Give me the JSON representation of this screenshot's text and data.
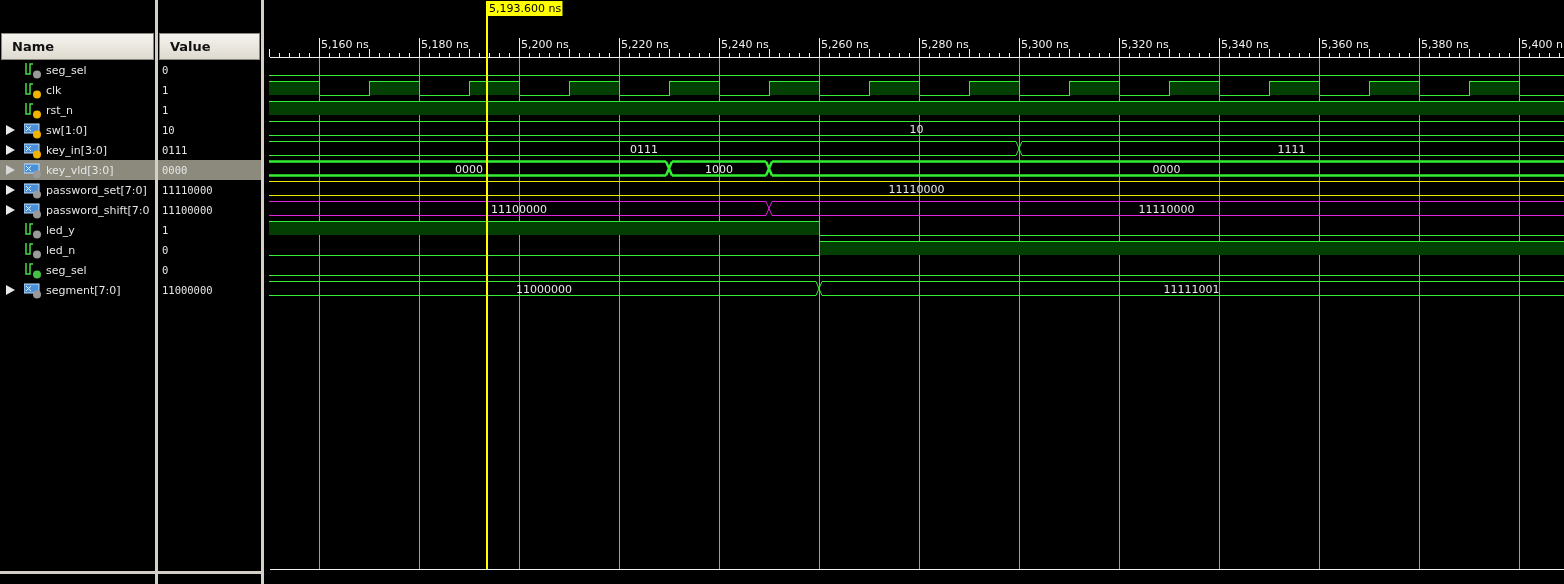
{
  "cursor": {
    "time": "5,193.600 ns"
  },
  "columns": {
    "name": "Name",
    "value": "Value"
  },
  "ruler": {
    "labels": [
      "5,160 ns",
      "5,180 ns",
      "5,200 ns",
      "5,220 ns",
      "5,240 ns",
      "5,260 ns",
      "5,280 ns",
      "5,300 ns",
      "5,320 ns",
      "5,340 ns",
      "5,360 ns",
      "5,380 ns",
      "5,400 n"
    ]
  },
  "signals": [
    {
      "name": "seg_sel",
      "value": "0",
      "kind": "bit",
      "badge": {
        "color": "#9a9a9a"
      },
      "selected": false,
      "slots": [
        {
          "high": false
        },
        {
          "high": false
        },
        {
          "high": false
        },
        {
          "high": false
        },
        {
          "high": false
        },
        {
          "high": false
        },
        {
          "high": false
        },
        {
          "high": false
        },
        {
          "high": false
        },
        {
          "high": false
        },
        {
          "high": false
        },
        {
          "high": false
        },
        {
          "high": false
        },
        {
          "high": false
        },
        {
          "high": false
        },
        {
          "high": false
        },
        {
          "high": false
        },
        {
          "high": false
        },
        {
          "high": false
        },
        {
          "high": false
        },
        {
          "high": false
        },
        {
          "high": false
        },
        {
          "high": false
        },
        {
          "high": false
        },
        {
          "high": false
        },
        {
          "high": false
        }
      ]
    },
    {
      "name": "clk",
      "value": "1",
      "kind": "bit",
      "badge": {
        "color": "#f0b400"
      },
      "selected": false,
      "slots": [
        {
          "high": true
        },
        {
          "high": false
        },
        {
          "high": true
        },
        {
          "high": false
        },
        {
          "high": true
        },
        {
          "high": false
        },
        {
          "high": true
        },
        {
          "high": false
        },
        {
          "high": true
        },
        {
          "high": false
        },
        {
          "high": true
        },
        {
          "high": false
        },
        {
          "high": true
        },
        {
          "high": false
        },
        {
          "high": true
        },
        {
          "high": false
        },
        {
          "high": true
        },
        {
          "high": false
        },
        {
          "high": true
        },
        {
          "high": false
        },
        {
          "high": true
        },
        {
          "high": false
        },
        {
          "high": true
        },
        {
          "high": false
        },
        {
          "high": true
        },
        {
          "high": false
        }
      ]
    },
    {
      "name": "rst_n",
      "value": "1",
      "kind": "bit",
      "badge": {
        "color": "#f0b400"
      },
      "selected": false,
      "slots": [
        {
          "high": true
        },
        {
          "high": true
        },
        {
          "high": true
        },
        {
          "high": true
        },
        {
          "high": true
        },
        {
          "high": true
        },
        {
          "high": true
        },
        {
          "high": true
        },
        {
          "high": true
        },
        {
          "high": true
        },
        {
          "high": true
        },
        {
          "high": true
        },
        {
          "high": true
        },
        {
          "high": true
        },
        {
          "high": true
        },
        {
          "high": true
        },
        {
          "high": true
        },
        {
          "high": true
        },
        {
          "high": true
        },
        {
          "high": true
        },
        {
          "high": true
        },
        {
          "high": true
        },
        {
          "high": true
        },
        {
          "high": true
        },
        {
          "high": true
        },
        {
          "high": true
        }
      ]
    },
    {
      "name": "sw[1:0]",
      "value": "10",
      "kind": "bus",
      "badge": {
        "color": "#f0b400"
      },
      "selected": false,
      "color": "#33ee33",
      "labels": [
        "10"
      ],
      "slots": [
        {
          "edge": false
        },
        {
          "edge": false
        },
        {
          "edge": false
        },
        {
          "edge": false
        },
        {
          "edge": false
        },
        {
          "edge": false
        },
        {
          "edge": false
        },
        {
          "edge": false
        },
        {
          "edge": false
        },
        {
          "edge": false
        },
        {
          "edge": false
        },
        {
          "edge": false
        },
        {
          "edge": false
        },
        {
          "edge": false
        },
        {
          "edge": false
        },
        {
          "edge": false
        },
        {
          "edge": false
        },
        {
          "edge": false
        },
        {
          "edge": false
        },
        {
          "edge": false
        },
        {
          "edge": false
        },
        {
          "edge": false
        },
        {
          "edge": false
        },
        {
          "edge": false
        },
        {
          "edge": false
        },
        {
          "edge": false
        }
      ]
    },
    {
      "name": "key_in[3:0]",
      "value": "0111",
      "kind": "bus",
      "badge": {
        "color": "#f0b400"
      },
      "selected": false,
      "color": "#33ee33",
      "labels": [
        "0111",
        "1111"
      ],
      "slots": [
        {
          "edge": false
        },
        {
          "edge": false
        },
        {
          "edge": false
        },
        {
          "edge": false
        },
        {
          "edge": false
        },
        {
          "edge": false
        },
        {
          "edge": false
        },
        {
          "edge": false
        },
        {
          "edge": false
        },
        {
          "edge": false
        },
        {
          "edge": false
        },
        {
          "edge": false
        },
        {
          "edge": false
        },
        {
          "edge": false
        },
        {
          "edge": false
        },
        {
          "edge": true
        },
        {
          "edge": false
        },
        {
          "edge": false
        },
        {
          "edge": false
        },
        {
          "edge": false
        },
        {
          "edge": false
        },
        {
          "edge": false
        },
        {
          "edge": false
        },
        {
          "edge": false
        },
        {
          "edge": false
        },
        {
          "edge": false
        }
      ]
    },
    {
      "name": "key_vld[3:0]",
      "value": "0000",
      "kind": "bus",
      "badge": {
        "color": "#9a9a9a"
      },
      "selected": true,
      "color": "#33ee33",
      "labels": [
        "0000",
        "1000",
        "0000"
      ],
      "slots": [
        {
          "edge": false
        },
        {
          "edge": false
        },
        {
          "edge": false
        },
        {
          "edge": false
        },
        {
          "edge": false
        },
        {
          "edge": false
        },
        {
          "edge": false
        },
        {
          "edge": false
        },
        {
          "edge": true
        },
        {
          "edge": false
        },
        {
          "edge": true
        },
        {
          "edge": false
        },
        {
          "edge": false
        },
        {
          "edge": false
        },
        {
          "edge": false
        },
        {
          "edge": false
        },
        {
          "edge": false
        },
        {
          "edge": false
        },
        {
          "edge": false
        },
        {
          "edge": false
        },
        {
          "edge": false
        },
        {
          "edge": false
        },
        {
          "edge": false
        },
        {
          "edge": false
        },
        {
          "edge": false
        },
        {
          "edge": false
        }
      ]
    },
    {
      "name": "password_set[7:0]",
      "value": "11110000",
      "kind": "bus",
      "badge": {
        "color": "#9a9a9a"
      },
      "selected": false,
      "color": "#e8e800",
      "labels": [
        "11110000"
      ],
      "slots": [
        {
          "edge": false
        },
        {
          "edge": false
        },
        {
          "edge": false
        },
        {
          "edge": false
        },
        {
          "edge": false
        },
        {
          "edge": false
        },
        {
          "edge": false
        },
        {
          "edge": false
        },
        {
          "edge": false
        },
        {
          "edge": false
        },
        {
          "edge": false
        },
        {
          "edge": false
        },
        {
          "edge": false
        },
        {
          "edge": false
        },
        {
          "edge": false
        },
        {
          "edge": false
        },
        {
          "edge": false
        },
        {
          "edge": false
        },
        {
          "edge": false
        },
        {
          "edge": false
        },
        {
          "edge": false
        },
        {
          "edge": false
        },
        {
          "edge": false
        },
        {
          "edge": false
        },
        {
          "edge": false
        },
        {
          "edge": false
        }
      ]
    },
    {
      "name": "password_shift[7:0",
      "value": "11100000",
      "kind": "bus",
      "badge": {
        "color": "#9a9a9a"
      },
      "selected": false,
      "color": "#e020e0",
      "labels": [
        "11100000",
        "11110000"
      ],
      "slots": [
        {
          "edge": false
        },
        {
          "edge": false
        },
        {
          "edge": false
        },
        {
          "edge": false
        },
        {
          "edge": false
        },
        {
          "edge": false
        },
        {
          "edge": false
        },
        {
          "edge": false
        },
        {
          "edge": false
        },
        {
          "edge": false
        },
        {
          "edge": true
        },
        {
          "edge": false
        },
        {
          "edge": false
        },
        {
          "edge": false
        },
        {
          "edge": false
        },
        {
          "edge": false
        },
        {
          "edge": false
        },
        {
          "edge": false
        },
        {
          "edge": false
        },
        {
          "edge": false
        },
        {
          "edge": false
        },
        {
          "edge": false
        },
        {
          "edge": false
        },
        {
          "edge": false
        },
        {
          "edge": false
        },
        {
          "edge": false
        }
      ]
    },
    {
      "name": "led_y",
      "value": "1",
      "kind": "bit",
      "badge": {
        "color": "#9a9a9a"
      },
      "selected": false,
      "slots": [
        {
          "high": true
        },
        {
          "high": true
        },
        {
          "high": true
        },
        {
          "high": true
        },
        {
          "high": true
        },
        {
          "high": true
        },
        {
          "high": true
        },
        {
          "high": true
        },
        {
          "high": true
        },
        {
          "high": true
        },
        {
          "high": true
        },
        {
          "high": false
        },
        {
          "high": false
        },
        {
          "high": false
        },
        {
          "high": false
        },
        {
          "high": false
        },
        {
          "high": false
        },
        {
          "high": false
        },
        {
          "high": false
        },
        {
          "high": false
        },
        {
          "high": false
        },
        {
          "high": false
        },
        {
          "high": false
        },
        {
          "high": false
        },
        {
          "high": false
        },
        {
          "high": false
        }
      ]
    },
    {
      "name": "led_n",
      "value": "0",
      "kind": "bit",
      "badge": {
        "color": "#9a9a9a"
      },
      "selected": false,
      "slots": [
        {
          "high": false
        },
        {
          "high": false
        },
        {
          "high": false
        },
        {
          "high": false
        },
        {
          "high": false
        },
        {
          "high": false
        },
        {
          "high": false
        },
        {
          "high": false
        },
        {
          "high": false
        },
        {
          "high": false
        },
        {
          "high": false
        },
        {
          "high": true
        },
        {
          "high": true
        },
        {
          "high": true
        },
        {
          "high": true
        },
        {
          "high": true
        },
        {
          "high": true
        },
        {
          "high": true
        },
        {
          "high": true
        },
        {
          "high": true
        },
        {
          "high": true
        },
        {
          "high": true
        },
        {
          "high": true
        },
        {
          "high": true
        },
        {
          "high": true
        },
        {
          "high": true
        }
      ]
    },
    {
      "name": "seg_sel",
      "value": "0",
      "kind": "bit",
      "badge": {
        "color": "#44c044"
      },
      "selected": false,
      "slots": [
        {
          "high": false
        },
        {
          "high": false
        },
        {
          "high": false
        },
        {
          "high": false
        },
        {
          "high": false
        },
        {
          "high": false
        },
        {
          "high": false
        },
        {
          "high": false
        },
        {
          "high": false
        },
        {
          "high": false
        },
        {
          "high": false
        },
        {
          "high": false
        },
        {
          "high": false
        },
        {
          "high": false
        },
        {
          "high": false
        },
        {
          "high": false
        },
        {
          "high": false
        },
        {
          "high": false
        },
        {
          "high": false
        },
        {
          "high": false
        },
        {
          "high": false
        },
        {
          "high": false
        },
        {
          "high": false
        },
        {
          "high": false
        },
        {
          "high": false
        },
        {
          "high": false
        }
      ]
    },
    {
      "name": "segment[7:0]",
      "value": "11000000",
      "kind": "bus",
      "badge": {
        "color": "#9a9a9a"
      },
      "selected": false,
      "color": "#33ee33",
      "labels": [
        "11000000",
        "11111001"
      ],
      "slots": [
        {
          "edge": false
        },
        {
          "edge": false
        },
        {
          "edge": false
        },
        {
          "edge": false
        },
        {
          "edge": false
        },
        {
          "edge": false
        },
        {
          "edge": false
        },
        {
          "edge": false
        },
        {
          "edge": false
        },
        {
          "edge": false
        },
        {
          "edge": false
        },
        {
          "edge": true
        },
        {
          "edge": false
        },
        {
          "edge": false
        },
        {
          "edge": false
        },
        {
          "edge": false
        },
        {
          "edge": false
        },
        {
          "edge": false
        },
        {
          "edge": false
        },
        {
          "edge": false
        },
        {
          "edge": false
        },
        {
          "edge": false
        },
        {
          "edge": false
        },
        {
          "edge": false
        },
        {
          "edge": false
        },
        {
          "edge": false
        }
      ]
    }
  ]
}
